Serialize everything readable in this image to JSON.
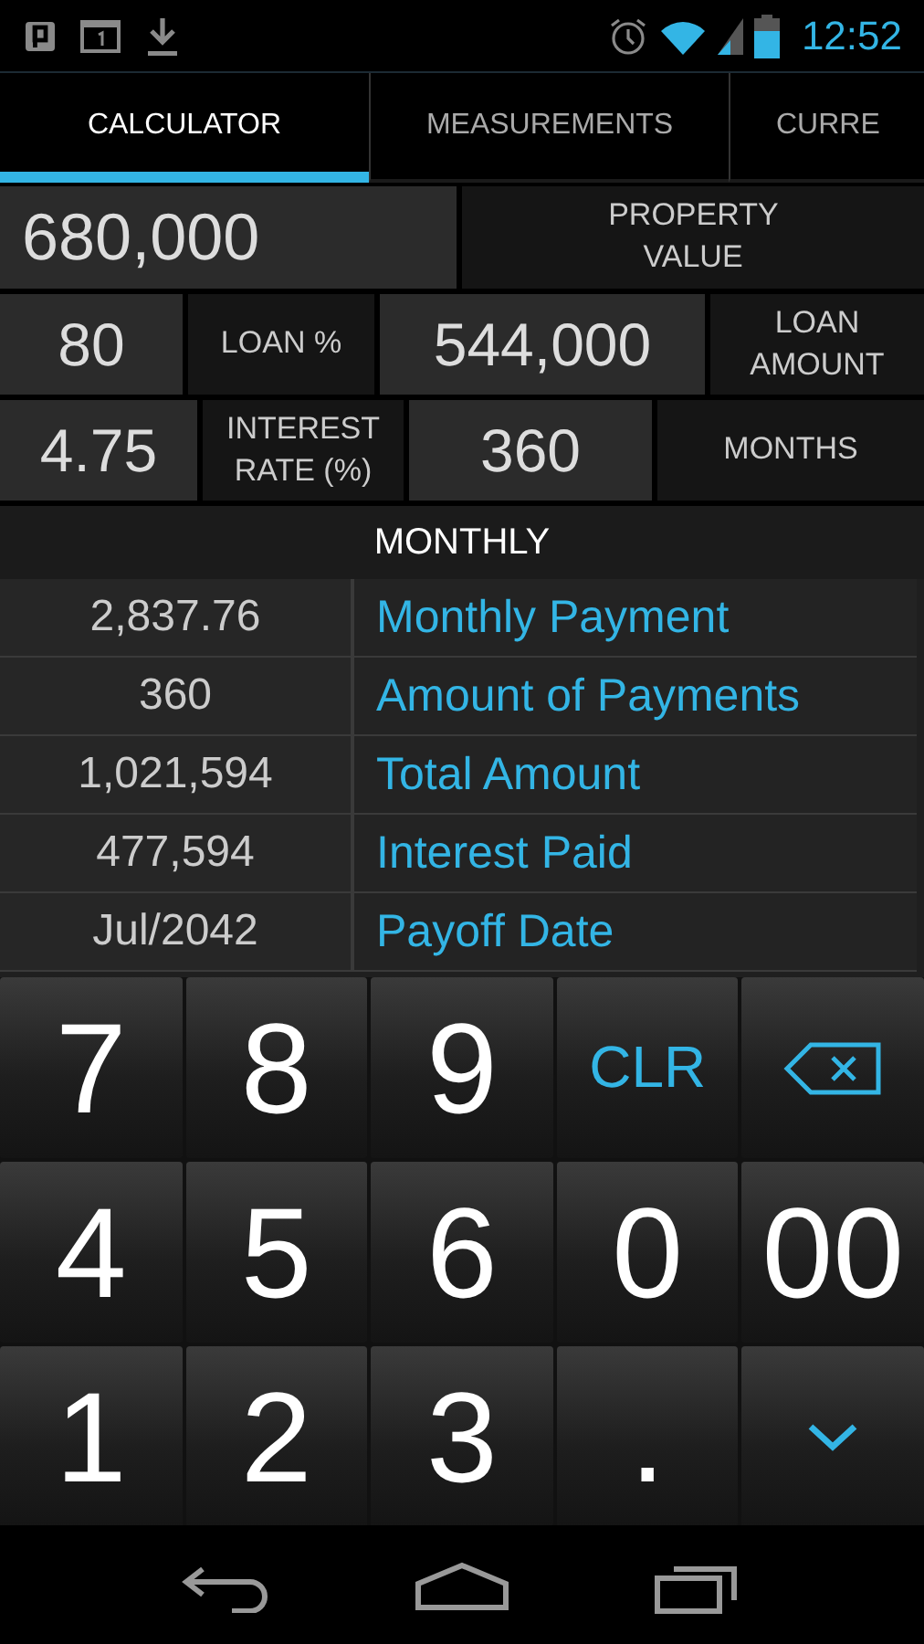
{
  "status_bar": {
    "time": "12:52"
  },
  "tabs": [
    {
      "label": "CALCULATOR",
      "selected": true
    },
    {
      "label": "MEASUREMENTS",
      "selected": false
    },
    {
      "label": "CURRE",
      "selected": false
    }
  ],
  "inputs": [
    [
      {
        "kind": "value",
        "text": "680,000"
      },
      {
        "kind": "label",
        "text": "PROPERTY VALUE"
      }
    ],
    [
      {
        "kind": "value",
        "text": "80"
      },
      {
        "kind": "label",
        "text": "LOAN %"
      },
      {
        "kind": "value",
        "text": "544,000"
      },
      {
        "kind": "label",
        "text": "LOAN AMOUNT"
      }
    ],
    [
      {
        "kind": "value",
        "text": "4.75"
      },
      {
        "kind": "label",
        "text": "INTEREST RATE (%)"
      },
      {
        "kind": "value",
        "text": "360"
      },
      {
        "kind": "label",
        "text": "MONTHS"
      }
    ]
  ],
  "section": "MONTHLY",
  "results": [
    {
      "value": "2,837.76",
      "label": "Monthly Payment"
    },
    {
      "value": "360",
      "label": "Amount of Payments"
    },
    {
      "value": "1,021,594",
      "label": "Total Amount"
    },
    {
      "value": "477,594",
      "label": "Interest Paid"
    },
    {
      "value": "Jul/2042",
      "label": "Payoff Date"
    }
  ],
  "keypad": [
    {
      "kind": "digit",
      "text": "7"
    },
    {
      "kind": "digit",
      "text": "8"
    },
    {
      "kind": "digit",
      "text": "9"
    },
    {
      "kind": "action",
      "text": "CLR"
    },
    {
      "kind": "backspace"
    },
    {
      "kind": "digit",
      "text": "4"
    },
    {
      "kind": "digit",
      "text": "5"
    },
    {
      "kind": "digit",
      "text": "6"
    },
    {
      "kind": "digit",
      "text": "0"
    },
    {
      "kind": "digit",
      "text": "00"
    },
    {
      "kind": "digit",
      "text": "1"
    },
    {
      "kind": "digit",
      "text": "2"
    },
    {
      "kind": "digit",
      "text": "3"
    },
    {
      "kind": "digit",
      "text": "."
    },
    {
      "kind": "hide"
    }
  ]
}
